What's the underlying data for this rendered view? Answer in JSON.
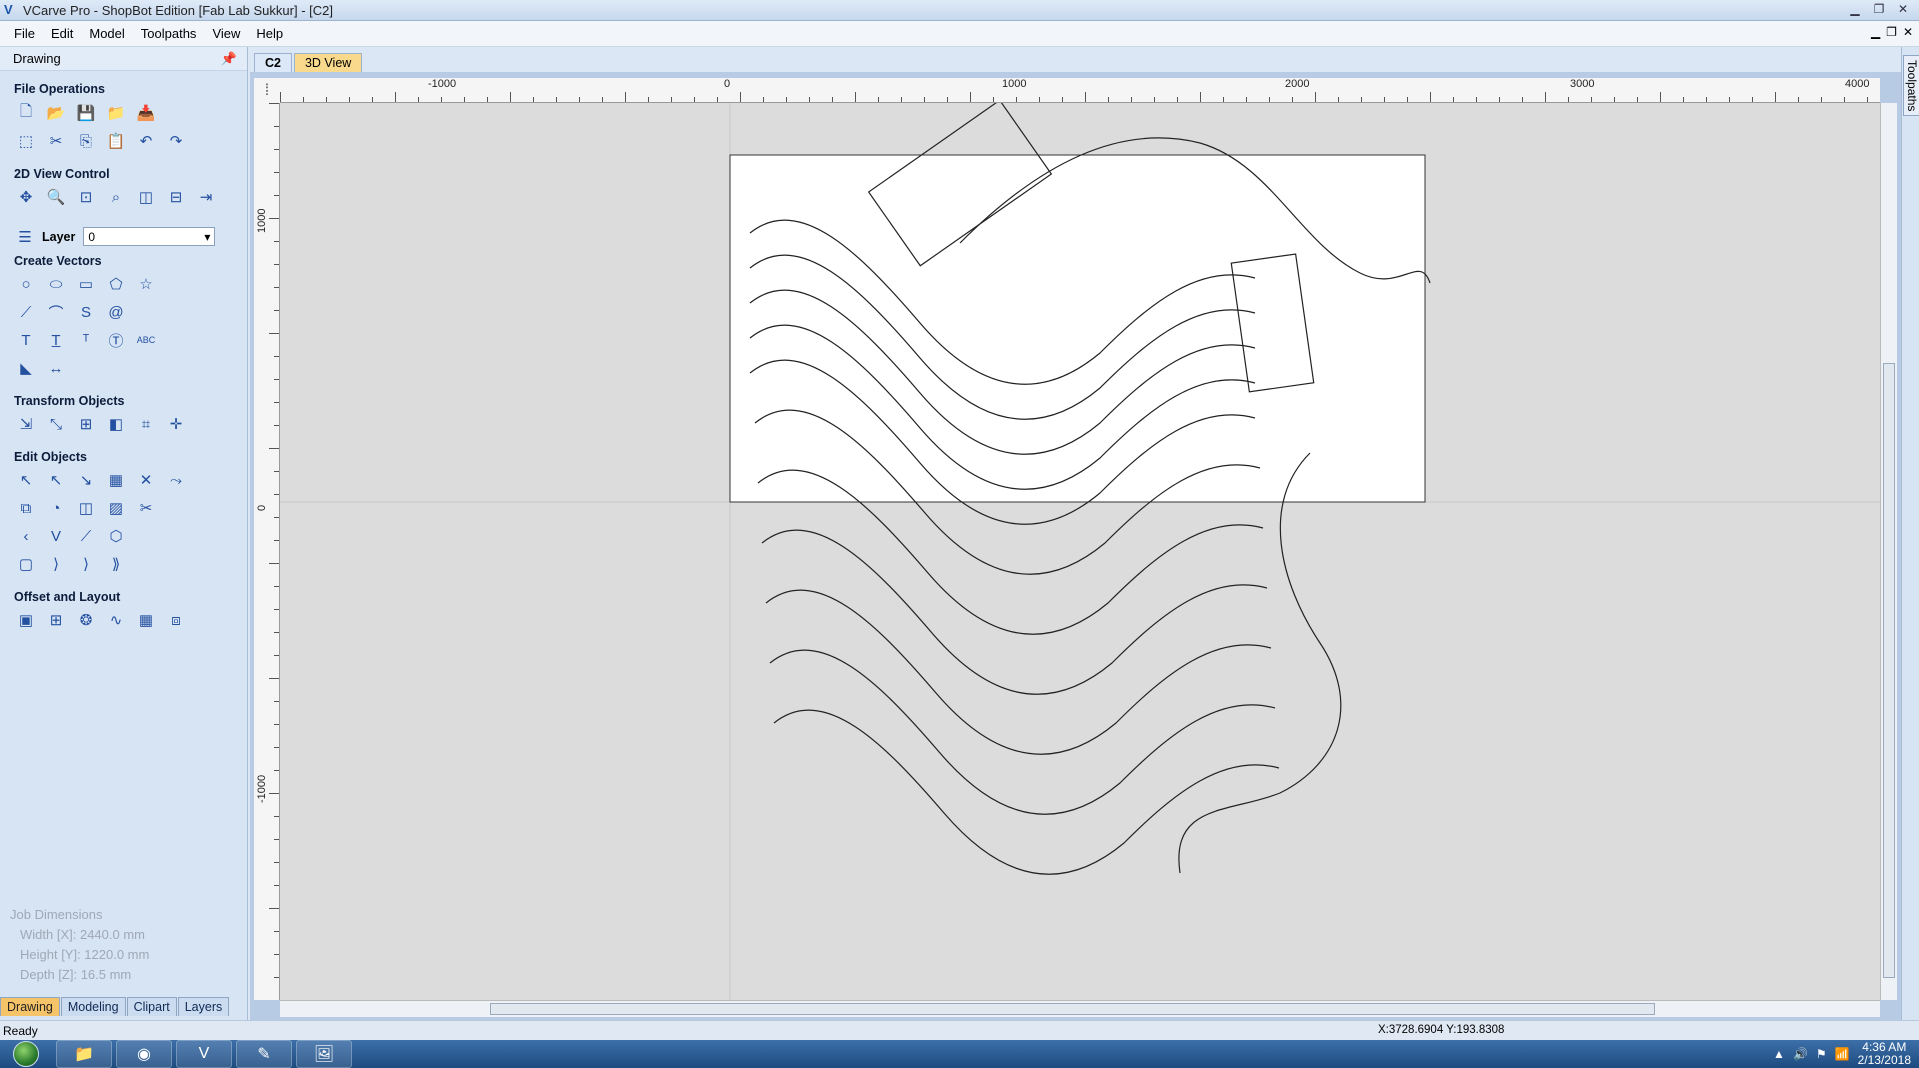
{
  "window": {
    "title": "VCarve Pro - ShopBot Edition [Fab Lab Sukkur] - [C2]",
    "controls": [
      "minimize",
      "restore",
      "close"
    ]
  },
  "menu": [
    "File",
    "Edit",
    "Model",
    "Toolpaths",
    "View",
    "Help"
  ],
  "panel": {
    "title": "Drawing",
    "pin_icon": "pin-icon"
  },
  "sections": {
    "file_ops": "File Operations",
    "view_ctrl": "2D View Control",
    "create_vectors": "Create Vectors",
    "transform": "Transform Objects",
    "edit_objects": "Edit Objects",
    "offset_layout": "Offset and Layout"
  },
  "layer": {
    "label": "Layer",
    "value": "0"
  },
  "job": {
    "title": "Job Dimensions",
    "width": "Width  [X]: 2440.0 mm",
    "height": "Height [Y]: 1220.0 mm",
    "depth": "Depth  [Z]: 16.5 mm"
  },
  "bottom_tabs": [
    "Drawing",
    "Modeling",
    "Clipart",
    "Layers"
  ],
  "doc_tabs": [
    "C2",
    "3D View"
  ],
  "ruler": {
    "top_labels": [
      "-1000",
      "0",
      "1000",
      "2000",
      "3000",
      "4000"
    ],
    "left_labels": [
      "1000",
      "0",
      "-1000"
    ]
  },
  "side_tab": "Toolpaths",
  "status": {
    "text": "Ready",
    "coords": "X:3728.6904 Y:193.8308"
  },
  "taskbar": {
    "time": "4:36 AM",
    "date": "2/13/2018"
  },
  "colors": {
    "accent": "#f6c468",
    "panel": "#d6e4f4",
    "canvas": "#dcdcdc",
    "sheet": "#ffffff"
  }
}
